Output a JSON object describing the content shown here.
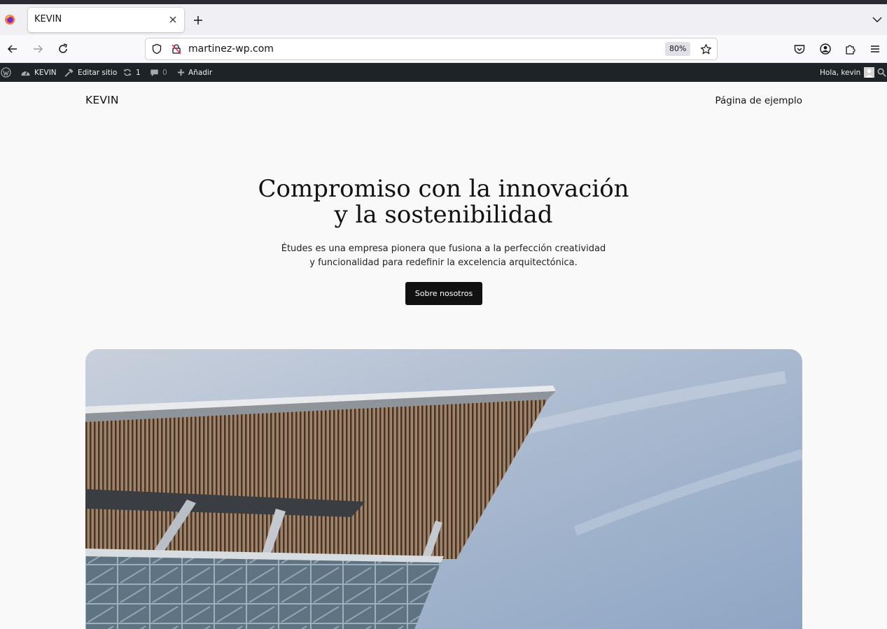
{
  "browser": {
    "tab_title": "KEVIN",
    "url": "martinez-wp.com",
    "zoom": "80%",
    "icons": [
      "firefox-icon",
      "close-icon",
      "plus-icon",
      "chevron-down-icon",
      "back-icon",
      "forward-icon",
      "reload-icon",
      "shield-icon",
      "lock-icon",
      "star-icon",
      "pocket-icon",
      "account-icon",
      "extensions-icon",
      "menu-icon"
    ]
  },
  "admin_bar": {
    "site_name": "KEVIN",
    "edit_site": "Editar sitio",
    "updates_count": "1",
    "comments_count": "0",
    "add_new": "Añadir",
    "greeting": "Hola, kevin"
  },
  "site": {
    "title": "KEVIN",
    "nav_link": "Página de ejemplo",
    "hero": {
      "title_line1": "Compromiso con la innovación",
      "title_line2": "y la sostenibilidad",
      "subtitle_line1": "Études es una empresa pionera que fusiona a la perfección creatividad",
      "subtitle_line2": "y funcionalidad para redefinir la excelencia arquitectónica.",
      "button_label": "Sobre nosotros"
    }
  },
  "colors": {
    "admin_bar": "#1d2327",
    "page_bg": "#f9f9f9",
    "button_bg": "#111111",
    "sky": "#9fb3cc"
  }
}
